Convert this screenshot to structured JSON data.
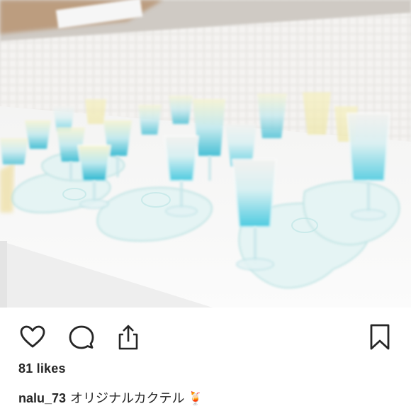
{
  "post": {
    "image_alt": "",
    "likes_text": "81 likes",
    "username": "nalu_73",
    "caption_text": "オリジナルカクテル",
    "caption_emoji": "🍹"
  },
  "actions": {
    "icons": [
      "heart-icon",
      "comment-icon",
      "share-icon",
      "bookmark-icon"
    ]
  },
  "colors": {
    "icon_stroke": "#262626",
    "text": "#262626",
    "cocktail_blue": "#3fc3d6",
    "cocktail_pale": "#f2f0c8"
  }
}
